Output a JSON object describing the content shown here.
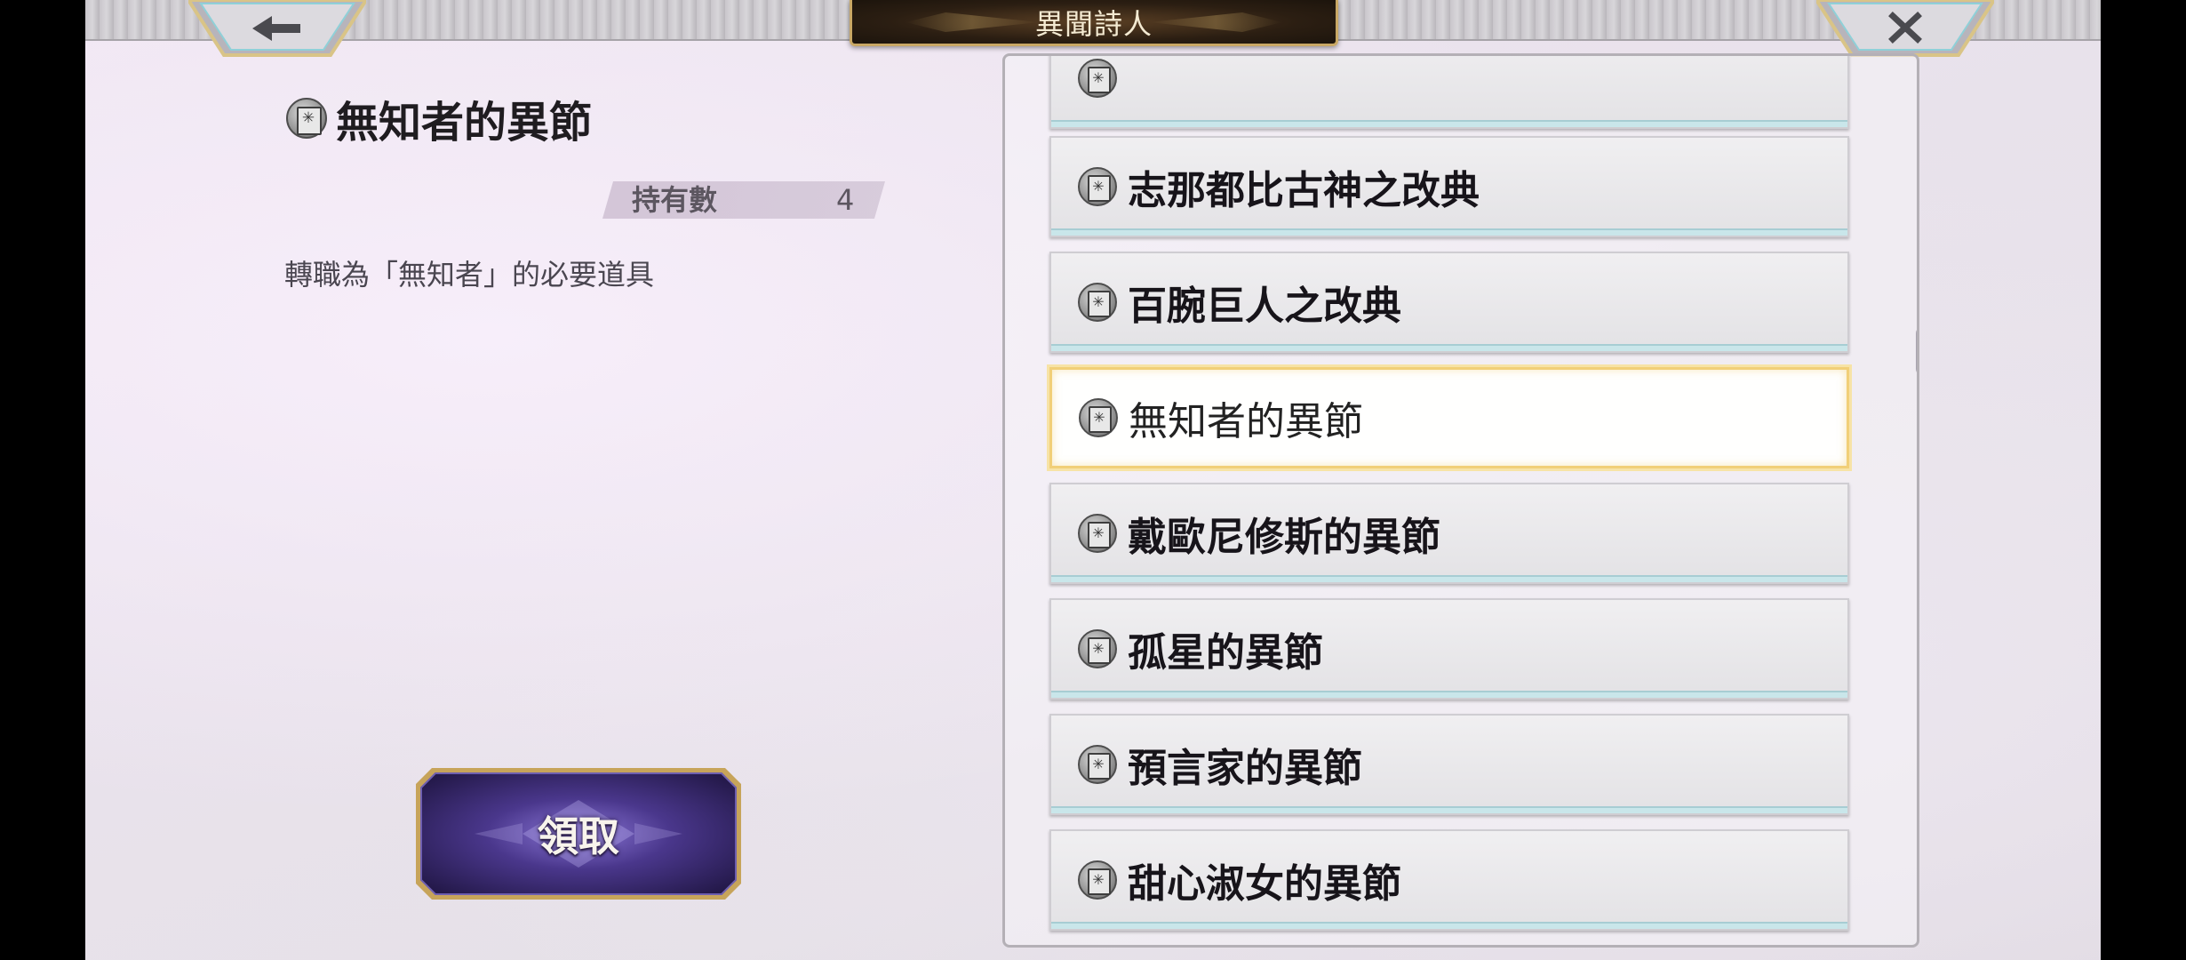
{
  "header": {
    "title": "異聞詩人",
    "back_icon": "arrow-left-icon",
    "close_icon": "close-icon"
  },
  "detail": {
    "title": "無知者的異節",
    "owned_label": "持有數",
    "owned_count": "4",
    "description": "轉職為「無知者」的必要道具"
  },
  "claim_button": {
    "label": "領取"
  },
  "list": {
    "items": [
      {
        "label": "",
        "selected": false
      },
      {
        "label": "志那都比古神之改典",
        "selected": false
      },
      {
        "label": "百腕巨人之改典",
        "selected": false
      },
      {
        "label": "無知者的異節",
        "selected": true
      },
      {
        "label": "戴歐尼修斯的異節",
        "selected": false
      },
      {
        "label": "孤星的異節",
        "selected": false
      },
      {
        "label": "預言家的異節",
        "selected": false
      },
      {
        "label": "甜心淑女的異節",
        "selected": false
      }
    ]
  },
  "colors": {
    "title_plate_border": "#c9a865",
    "selected_border": "#f1cf78",
    "claim_button_base": "#3b2a6e"
  }
}
